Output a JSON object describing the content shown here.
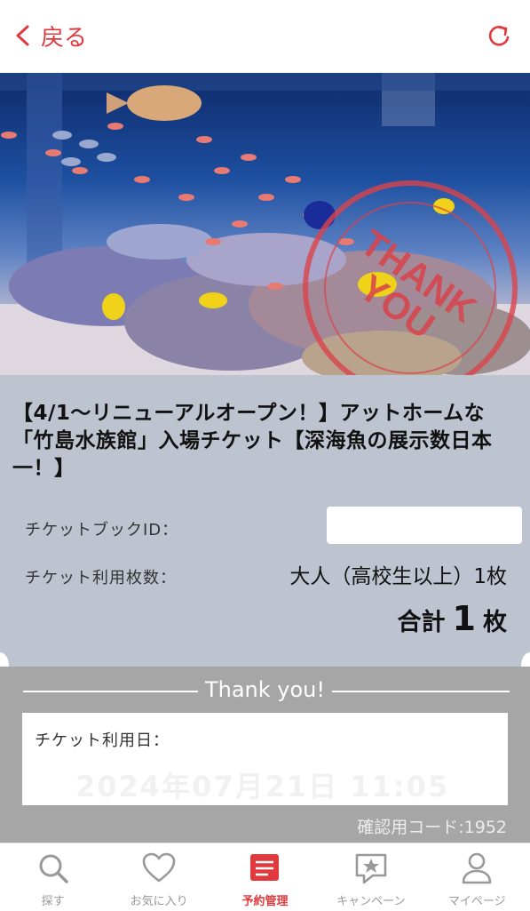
{
  "header": {
    "back_label": "戻る"
  },
  "ticket": {
    "title": "【4/1～リニューアルオープン！】アットホームな「竹島水族館」入場チケット【深海魚の展示数日本一！】",
    "id_label": "チケットブックID：",
    "count_label": "チケット利用枚数：",
    "count_value": "大人（高校生以上）1枚",
    "total_label": "合計",
    "total_num": "1",
    "total_unit": "枚"
  },
  "lower": {
    "thanks": "Thank you!",
    "use_date_label": "チケット利用日：",
    "use_date_value": "2024年07月21日 11:05",
    "confirm_code": "確認用コード:1952"
  },
  "stamp": {
    "text": "THANK YOU"
  },
  "nav": {
    "items": [
      {
        "label": "探す",
        "icon": "search-icon"
      },
      {
        "label": "お気に入り",
        "icon": "heart-icon"
      },
      {
        "label": "予約管理",
        "icon": "reservation-icon"
      },
      {
        "label": "キャンペーン",
        "icon": "campaign-icon"
      },
      {
        "label": "マイページ",
        "icon": "user-icon"
      }
    ]
  },
  "colors": {
    "accent": "#e0393e",
    "card": "#bdc3cf",
    "lower": "#a6a6a6"
  }
}
